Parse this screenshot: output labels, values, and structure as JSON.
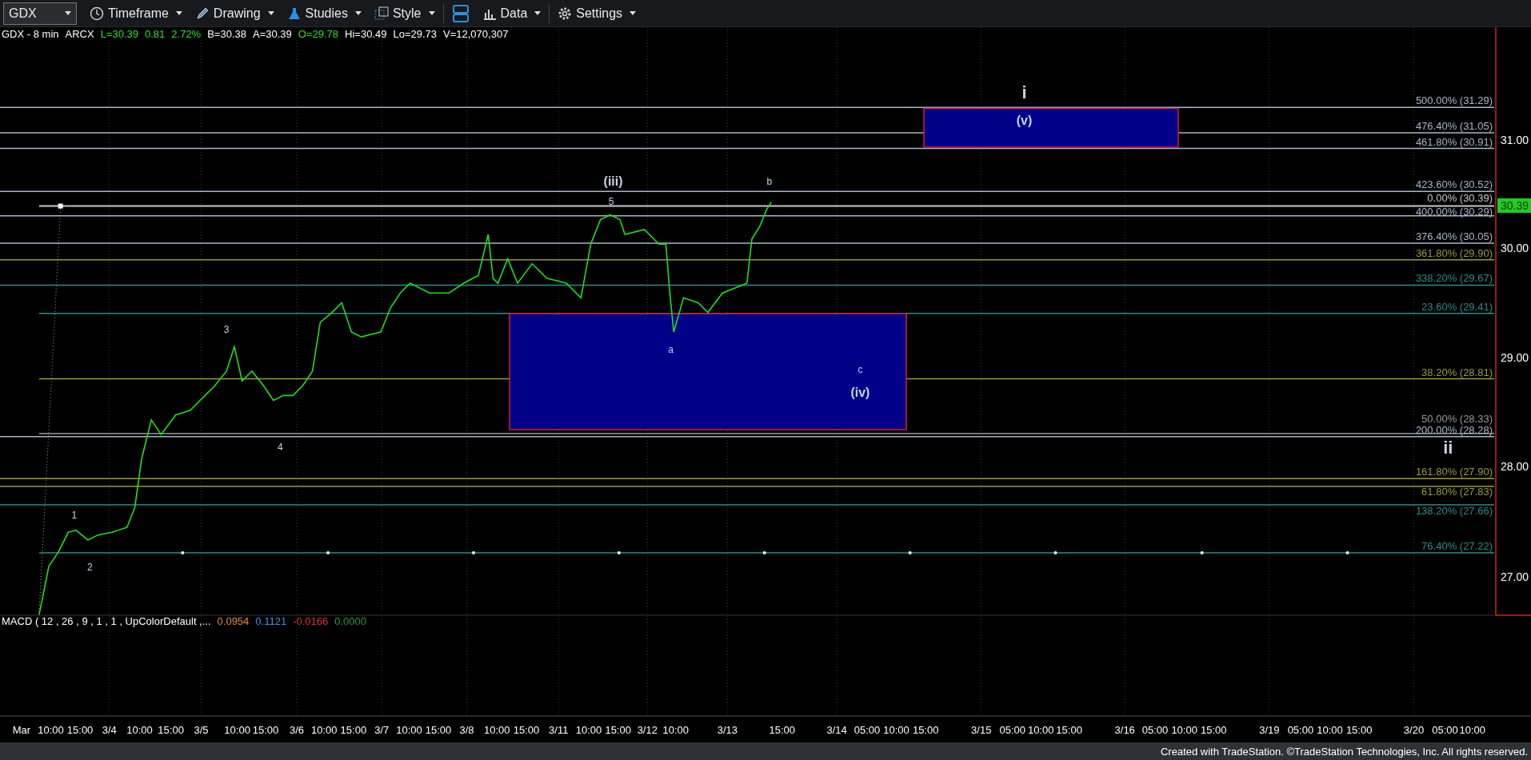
{
  "toolbar": {
    "symbol": "GDX",
    "menus": [
      {
        "label": "Timeframe"
      },
      {
        "label": "Drawing"
      },
      {
        "label": "Studies"
      },
      {
        "label": "Style"
      },
      {
        "label": "Data"
      },
      {
        "label": "Settings"
      }
    ]
  },
  "quote": [
    {
      "text": "GDX - 8 min",
      "color": "#ffffff"
    },
    {
      "text": "ARCX",
      "color": "#ffffff"
    },
    {
      "text": "L=30.39",
      "color": "#33dd33"
    },
    {
      "text": "0.81",
      "color": "#33dd33"
    },
    {
      "text": "2.72%",
      "color": "#33dd33"
    },
    {
      "text": "B=30.38",
      "color": "#ffffff"
    },
    {
      "text": "A=30.39",
      "color": "#ffffff"
    },
    {
      "text": "O=29.78",
      "color": "#33dd33"
    },
    {
      "text": "Hi=30.49",
      "color": "#ffffff"
    },
    {
      "text": "Lo=29.73",
      "color": "#ffffff"
    },
    {
      "text": "V=12,070,307",
      "color": "#ffffff"
    }
  ],
  "chart": {
    "price_axis": [
      "31.00",
      "30.00",
      "29.00",
      "28.00",
      "27.00"
    ],
    "last_price": "30.39",
    "fib_levels": [
      {
        "label": "500.00% (31.29)",
        "color": "#a9b4cc"
      },
      {
        "label": "476.40% (31.05)",
        "color": "#a9b4cc"
      },
      {
        "label": "461.80% (30.91)",
        "color": "#a9b4cc"
      },
      {
        "label": "423.60% (30.52)",
        "color": "#a9b4cc"
      },
      {
        "label": "0.00% (30.39)",
        "color": "#c8c8c8"
      },
      {
        "label": "400.00% (30.29)",
        "color": "#a9b4cc"
      },
      {
        "label": "376.40% (30.05)",
        "color": "#a9b4cc"
      },
      {
        "label": "361.80% (29.90)",
        "color": "#9a9a3a"
      },
      {
        "label": "338.20% (29.67)",
        "color": "#2f8a8a"
      },
      {
        "label": "23.60% (29.41)",
        "color": "#2f8a8a"
      },
      {
        "label": "38.20% (28.81)",
        "color": "#9a9a3a"
      },
      {
        "label": "50.00% (28.33)",
        "color": "#9a9a9a"
      },
      {
        "label": "200.00% (28.28)",
        "color": "#a9b4cc"
      },
      {
        "label": "161.80% (27.90)",
        "color": "#9a9a3a"
      },
      {
        "label": "61.80% (27.83)",
        "color": "#9a9a3a"
      },
      {
        "label": "138.20% (27.66)",
        "color": "#2f8a8a"
      },
      {
        "label": "76.40% (27.22)",
        "color": "#2f8a8a"
      }
    ],
    "wave_labels": [
      "i",
      "(v)",
      "(iii)",
      "b",
      "5",
      "3",
      "a",
      "c",
      "(iv)",
      "4",
      "ii",
      "1",
      "2"
    ],
    "time_axis": [
      "Mar",
      "10:00",
      "15:00",
      "3/4",
      "10:00",
      "15:00",
      "3/5",
      "10:00",
      "15:00",
      "3/6",
      "10:00",
      "15:00",
      "3/7",
      "10:00",
      "15:00",
      "3/8",
      "10:00",
      "15:00",
      "3/11",
      "10:00",
      "15:00",
      "3/12",
      "10:00",
      "3/13",
      "15:00",
      "3/14",
      "05:00",
      "10:00",
      "15:00",
      "3/15",
      "05:00",
      "10:00",
      "15:00",
      "3/16",
      "05:00",
      "10:00",
      "15:00",
      "3/19",
      "05:00",
      "10:00",
      "15:00",
      "3/20",
      "05:00",
      "10:00"
    ]
  },
  "macd": {
    "label": "MACD ( 12 , 26 , 9 , 1 , 1 , UpColorDefault ,...",
    "values": [
      {
        "text": "0.0954",
        "color": "#e8883a"
      },
      {
        "text": "0.1121",
        "color": "#4a8ce0"
      },
      {
        "text": "-0.0166",
        "color": "#e03030"
      },
      {
        "text": "0.0000",
        "color": "#2f9a2f"
      }
    ]
  },
  "footer": "Created with TradeStation. ©TradeStation Technologies, Inc. All rights reserved."
}
